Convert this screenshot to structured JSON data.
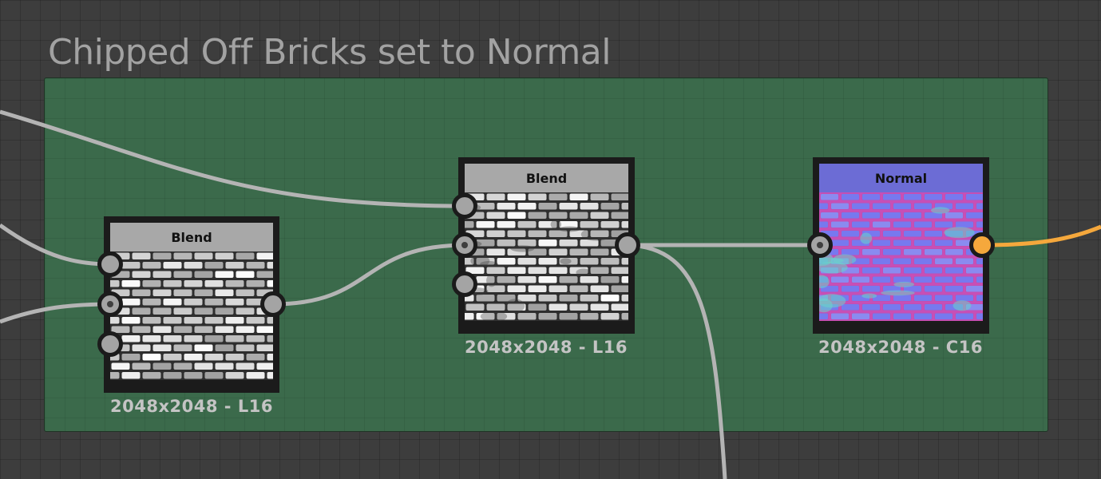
{
  "frame": {
    "title": "Chipped Off Bricks set to Normal",
    "color": "#3b6a4b"
  },
  "nodes": [
    {
      "id": "blend-1",
      "title": "Blend",
      "resolution": "2048x2048 - L16",
      "header_color": "#a8a8a8",
      "thumbnail": "grayscale-bricks",
      "inputs": 3,
      "outputs": 1
    },
    {
      "id": "blend-2",
      "title": "Blend",
      "resolution": "2048x2048 - L16",
      "header_color": "#a8a8a8",
      "thumbnail": "grayscale-chipped-bricks",
      "inputs": 3,
      "outputs": 1
    },
    {
      "id": "normal",
      "title": "Normal",
      "resolution": "2048x2048 - C16",
      "header_color": "#6c6cd5",
      "thumbnail": "normal-map-bricks",
      "inputs": 1,
      "outputs": 1
    }
  ],
  "colors": {
    "wire": "#b4b4b4",
    "output_wire": "#f5a83c",
    "canvas": "#3d3d3d"
  }
}
